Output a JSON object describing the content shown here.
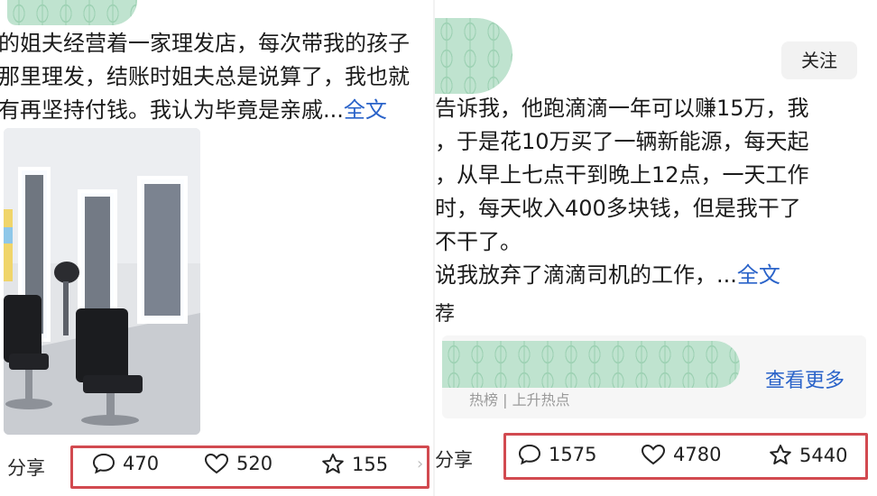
{
  "left_post": {
    "text_lines": [
      "的姐夫经营着一家理发店，每次带我的孩子",
      "那里理发，结账时姐夫总是说算了，我也就",
      "有再坚持付钱。我认为毕竟是亲戚..."
    ],
    "more_link": "全文",
    "share_label": "分享",
    "comments": "470",
    "likes": "520",
    "favorites": "155",
    "photo_icon": "barber-salon-photo"
  },
  "right_post": {
    "follow_label": "关注",
    "text_lines": [
      "告诉我，他跑滴滴一年可以赚15万，我",
      "，于是花10万买了一辆新能源，每天起",
      "，从早上七点干到晚上12点，一天工作",
      "时，每天收入400多块钱，但是我干了",
      "不干了。",
      "说我放弃了滴滴司机的工作，..."
    ],
    "more_link": "全文",
    "recommend_label": "荐",
    "hot_sub": "热榜 | 上升热点",
    "see_more": "查看更多",
    "share_label": "分享",
    "comments": "1575",
    "likes": "4780",
    "favorites": "5440"
  },
  "colors": {
    "link": "#2a63c9",
    "highlight_box": "#d24a50",
    "blur_green": "#bfe3cf"
  }
}
